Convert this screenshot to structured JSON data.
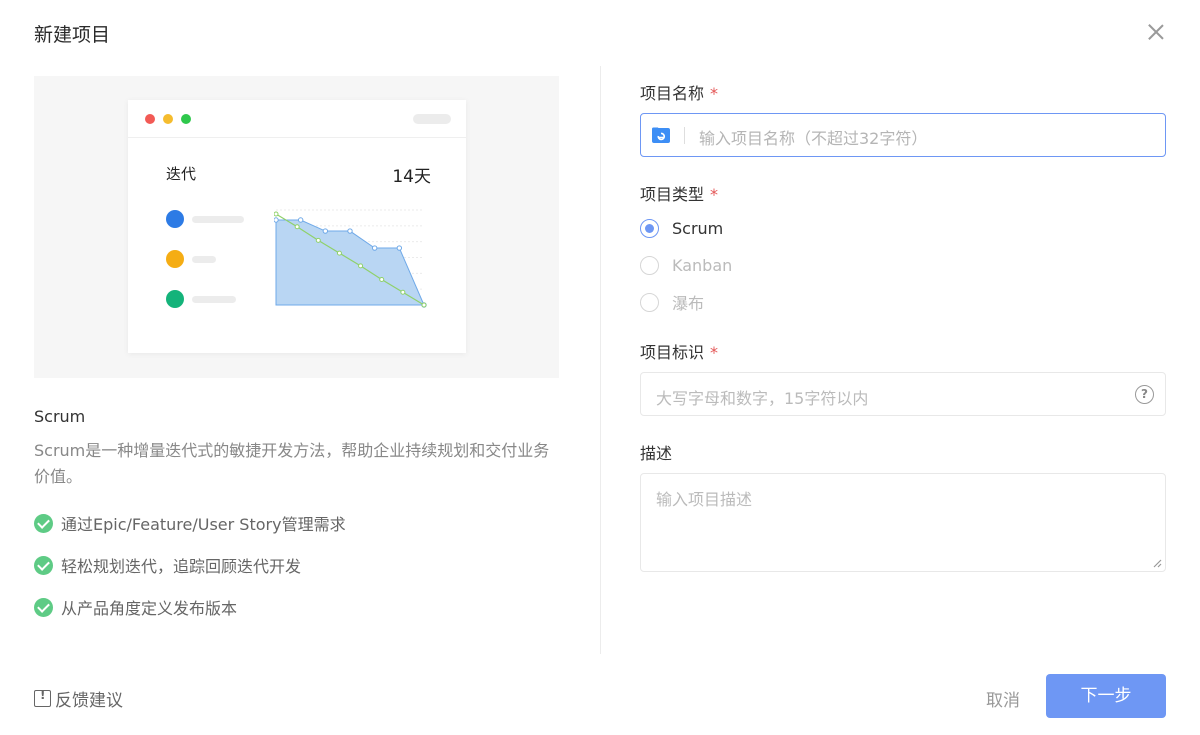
{
  "dialog": {
    "title": "新建项目"
  },
  "preview": {
    "card_label": "迭代",
    "card_days": "14天",
    "legend_colors": [
      "#2d7be5",
      "#f5ad14",
      "#14b37a"
    ],
    "chart_data": {
      "type": "area",
      "series": [
        {
          "values": [
            100,
            100,
            87,
            87,
            67,
            67,
            0
          ],
          "color": "#6fa9e8"
        },
        {
          "values": [
            100,
            86,
            71,
            57,
            43,
            28,
            14,
            0
          ],
          "color": "#8fd16a"
        }
      ]
    }
  },
  "scrum": {
    "title": "Scrum",
    "description": "Scrum是一种增量迭代式的敏捷开发方法，帮助企业持续规划和交付业务价值。",
    "features": [
      "通过Epic/Feature/User Story管理需求",
      "轻松规划迭代，追踪回顾迭代开发",
      "从产品角度定义发布版本"
    ]
  },
  "form": {
    "name_label": "项目名称",
    "name_placeholder": "输入项目名称（不超过32字符）",
    "type_label": "项目类型",
    "types": [
      "Scrum",
      "Kanban",
      "瀑布"
    ],
    "selected_type": "Scrum",
    "key_label": "项目标识",
    "key_placeholder": "大写字母和数字，15字符以内",
    "desc_label": "描述",
    "desc_placeholder": "输入项目描述",
    "required_mark": "*"
  },
  "footer": {
    "feedback": "反馈建议",
    "cancel": "取消",
    "next": "下一步"
  },
  "colors": {
    "accent": "#6e97f4",
    "required": "#e45555",
    "check": "#5ecb85"
  }
}
